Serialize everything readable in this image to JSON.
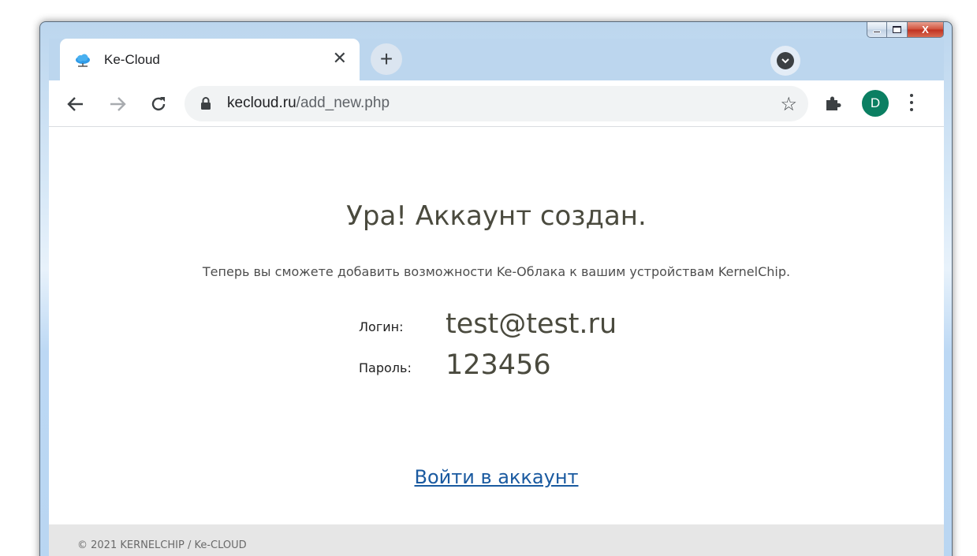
{
  "browser": {
    "tab": {
      "title": "Ke-Cloud",
      "close_glyph": "✕",
      "favicon": "cloud-icon"
    },
    "new_tab_glyph": "+",
    "omnibox": {
      "host": "kecloud.ru",
      "path": "/add_new.php"
    },
    "profile_initial": "D",
    "window_controls": {
      "close_glyph": "X"
    },
    "colors": {
      "tabstrip": "#bcd6ee",
      "avatar": "#0b7f62"
    }
  },
  "page": {
    "headline": "Ура! Аккаунт создан.",
    "subtext": "Теперь вы сможете добавить возможности Ke-Облака к вашим устройствам KernelChip.",
    "login_label": "Логин:",
    "login_value": "test@test.ru",
    "password_label": "Пароль:",
    "password_value": "123456",
    "login_link": "Войти в аккаунт",
    "footer": "© 2021 KERNELCHIP / Ke-CLOUD",
    "colors": {
      "link": "#1a5aa0",
      "footer_bg": "#e6e6e6"
    }
  }
}
